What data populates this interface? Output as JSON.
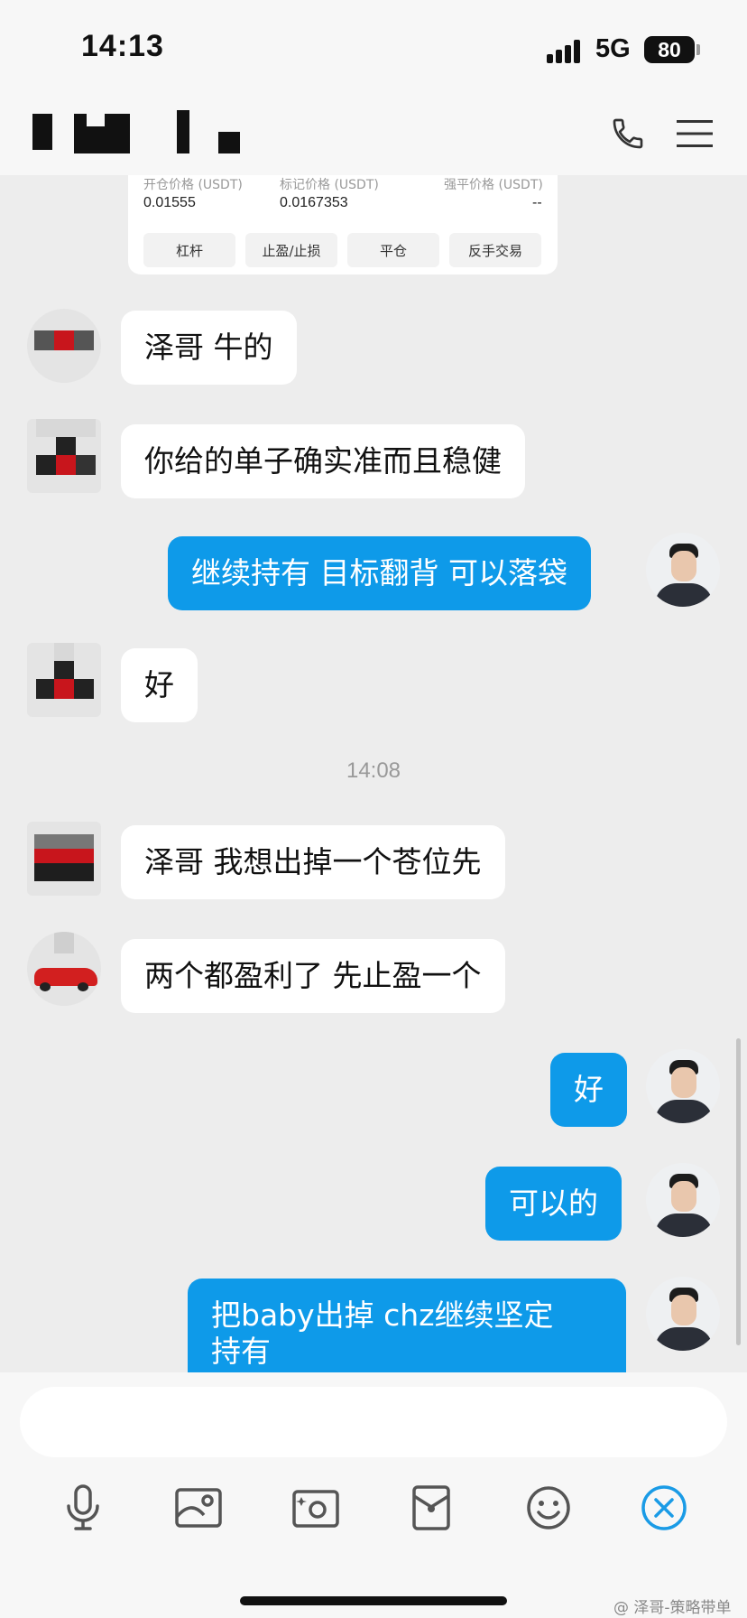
{
  "status_bar": {
    "time": "14:13",
    "network": "5G",
    "battery": "80"
  },
  "header": {
    "call_icon": "phone-icon",
    "menu_icon": "menu-icon"
  },
  "trade_card": {
    "stats": [
      {
        "label": "开仓价格 (USDT)",
        "value": "0.01555"
      },
      {
        "label": "标记价格 (USDT)",
        "value": "0.0167353"
      },
      {
        "label": "强平价格 (USDT)",
        "value": "--"
      }
    ],
    "buttons": [
      "杠杆",
      "止盈/止损",
      "平仓",
      "反手交易"
    ]
  },
  "messages": [
    {
      "side": "in",
      "text": "泽哥 牛的"
    },
    {
      "side": "in",
      "text": "你给的单子确实准而且稳健"
    },
    {
      "side": "out",
      "text": "继续持有 目标翻背 可以落袋"
    },
    {
      "side": "in",
      "text": "好"
    },
    {
      "side": "in",
      "text": "泽哥 我想出掉一个苍位先"
    },
    {
      "side": "in",
      "text": "两个都盈利了 先止盈一个"
    },
    {
      "side": "out",
      "text": "好"
    },
    {
      "side": "out",
      "text": "可以的"
    },
    {
      "side": "out",
      "lines": [
        "把baby出掉   chz继续坚定",
        "持有"
      ]
    }
  ],
  "time_divider": "14:08",
  "input": {
    "placeholder": ""
  },
  "toolbar": {
    "icons": [
      "microphone-icon",
      "image-icon",
      "camera-icon",
      "red-packet-icon",
      "emoji-icon",
      "close-icon"
    ]
  },
  "watermark": "@ 泽哥-策略带单",
  "colors": {
    "accent": "#0e9ae9",
    "background": "#ededed",
    "bubble_in": "#ffffff",
    "bubble_out": "#0e9ae9"
  }
}
